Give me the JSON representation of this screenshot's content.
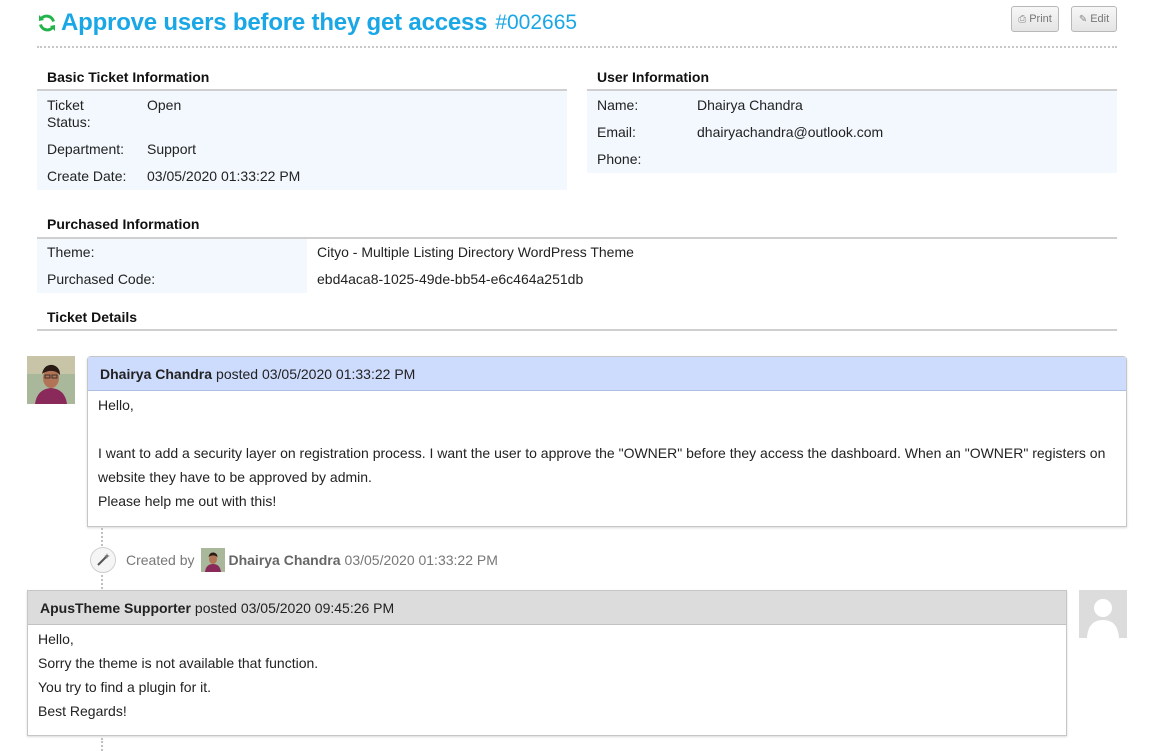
{
  "header": {
    "title": "Approve users before they get access",
    "ticket_number": "#002665",
    "print_label": "Print",
    "edit_label": "Edit"
  },
  "basic_info": {
    "heading": "Basic Ticket Information",
    "status_label_1": "Ticket",
    "status_label_2": "Status:",
    "status_value": "Open",
    "department_label": "Department:",
    "department_value": "Support",
    "create_date_label": "Create Date:",
    "create_date_value": "03/05/2020 01:33:22 PM"
  },
  "user_info": {
    "heading": "User Information",
    "name_label": "Name:",
    "name_value": "Dhairya Chandra",
    "email_label": "Email:",
    "email_value": "dhairyachandra@outlook.com",
    "phone_label": "Phone:",
    "phone_value": ""
  },
  "purchased_info": {
    "heading": "Purchased Information",
    "theme_label": "Theme:",
    "theme_value": "Cityo - Multiple Listing Directory WordPress Theme",
    "code_label": "Purchased Code:",
    "code_value": "ebd4aca8-1025-49de-bb54-e6c464a251db"
  },
  "ticket_details": {
    "heading": "Ticket Details"
  },
  "messages": [
    {
      "author": "Dhairya Chandra",
      "posted_text": "posted 03/05/2020 01:33:22 PM",
      "lines": [
        "Hello,",
        "I want to add a security layer on registration process. I want the user to approve the \"OWNER\" before they access the dashboard. When an \"OWNER\" registers on",
        "website they have to be approved by admin.",
        "Please help me out with this!"
      ]
    },
    {
      "author": "ApusTheme Supporter",
      "posted_text": "posted 03/05/2020 09:45:26 PM",
      "lines": [
        "Hello,",
        "Sorry the theme is not available that function.",
        "You try to find a plugin for it.",
        "Best Regards!"
      ]
    }
  ],
  "created_event": {
    "prefix": "Created by",
    "name": "Dhairya Chandra",
    "time": "03/05/2020 01:33:22 PM"
  },
  "colors": {
    "accent": "#1aa7e6",
    "refresh_icon": "#22b34b",
    "info_panel": "#f2f8fd",
    "customer_header": "#cddcfd",
    "staff_header": "#dcdcdc"
  },
  "icons": {
    "refresh": "refresh-icon",
    "print": "print-icon",
    "edit": "edit-icon",
    "wand": "magic-wand-icon"
  }
}
